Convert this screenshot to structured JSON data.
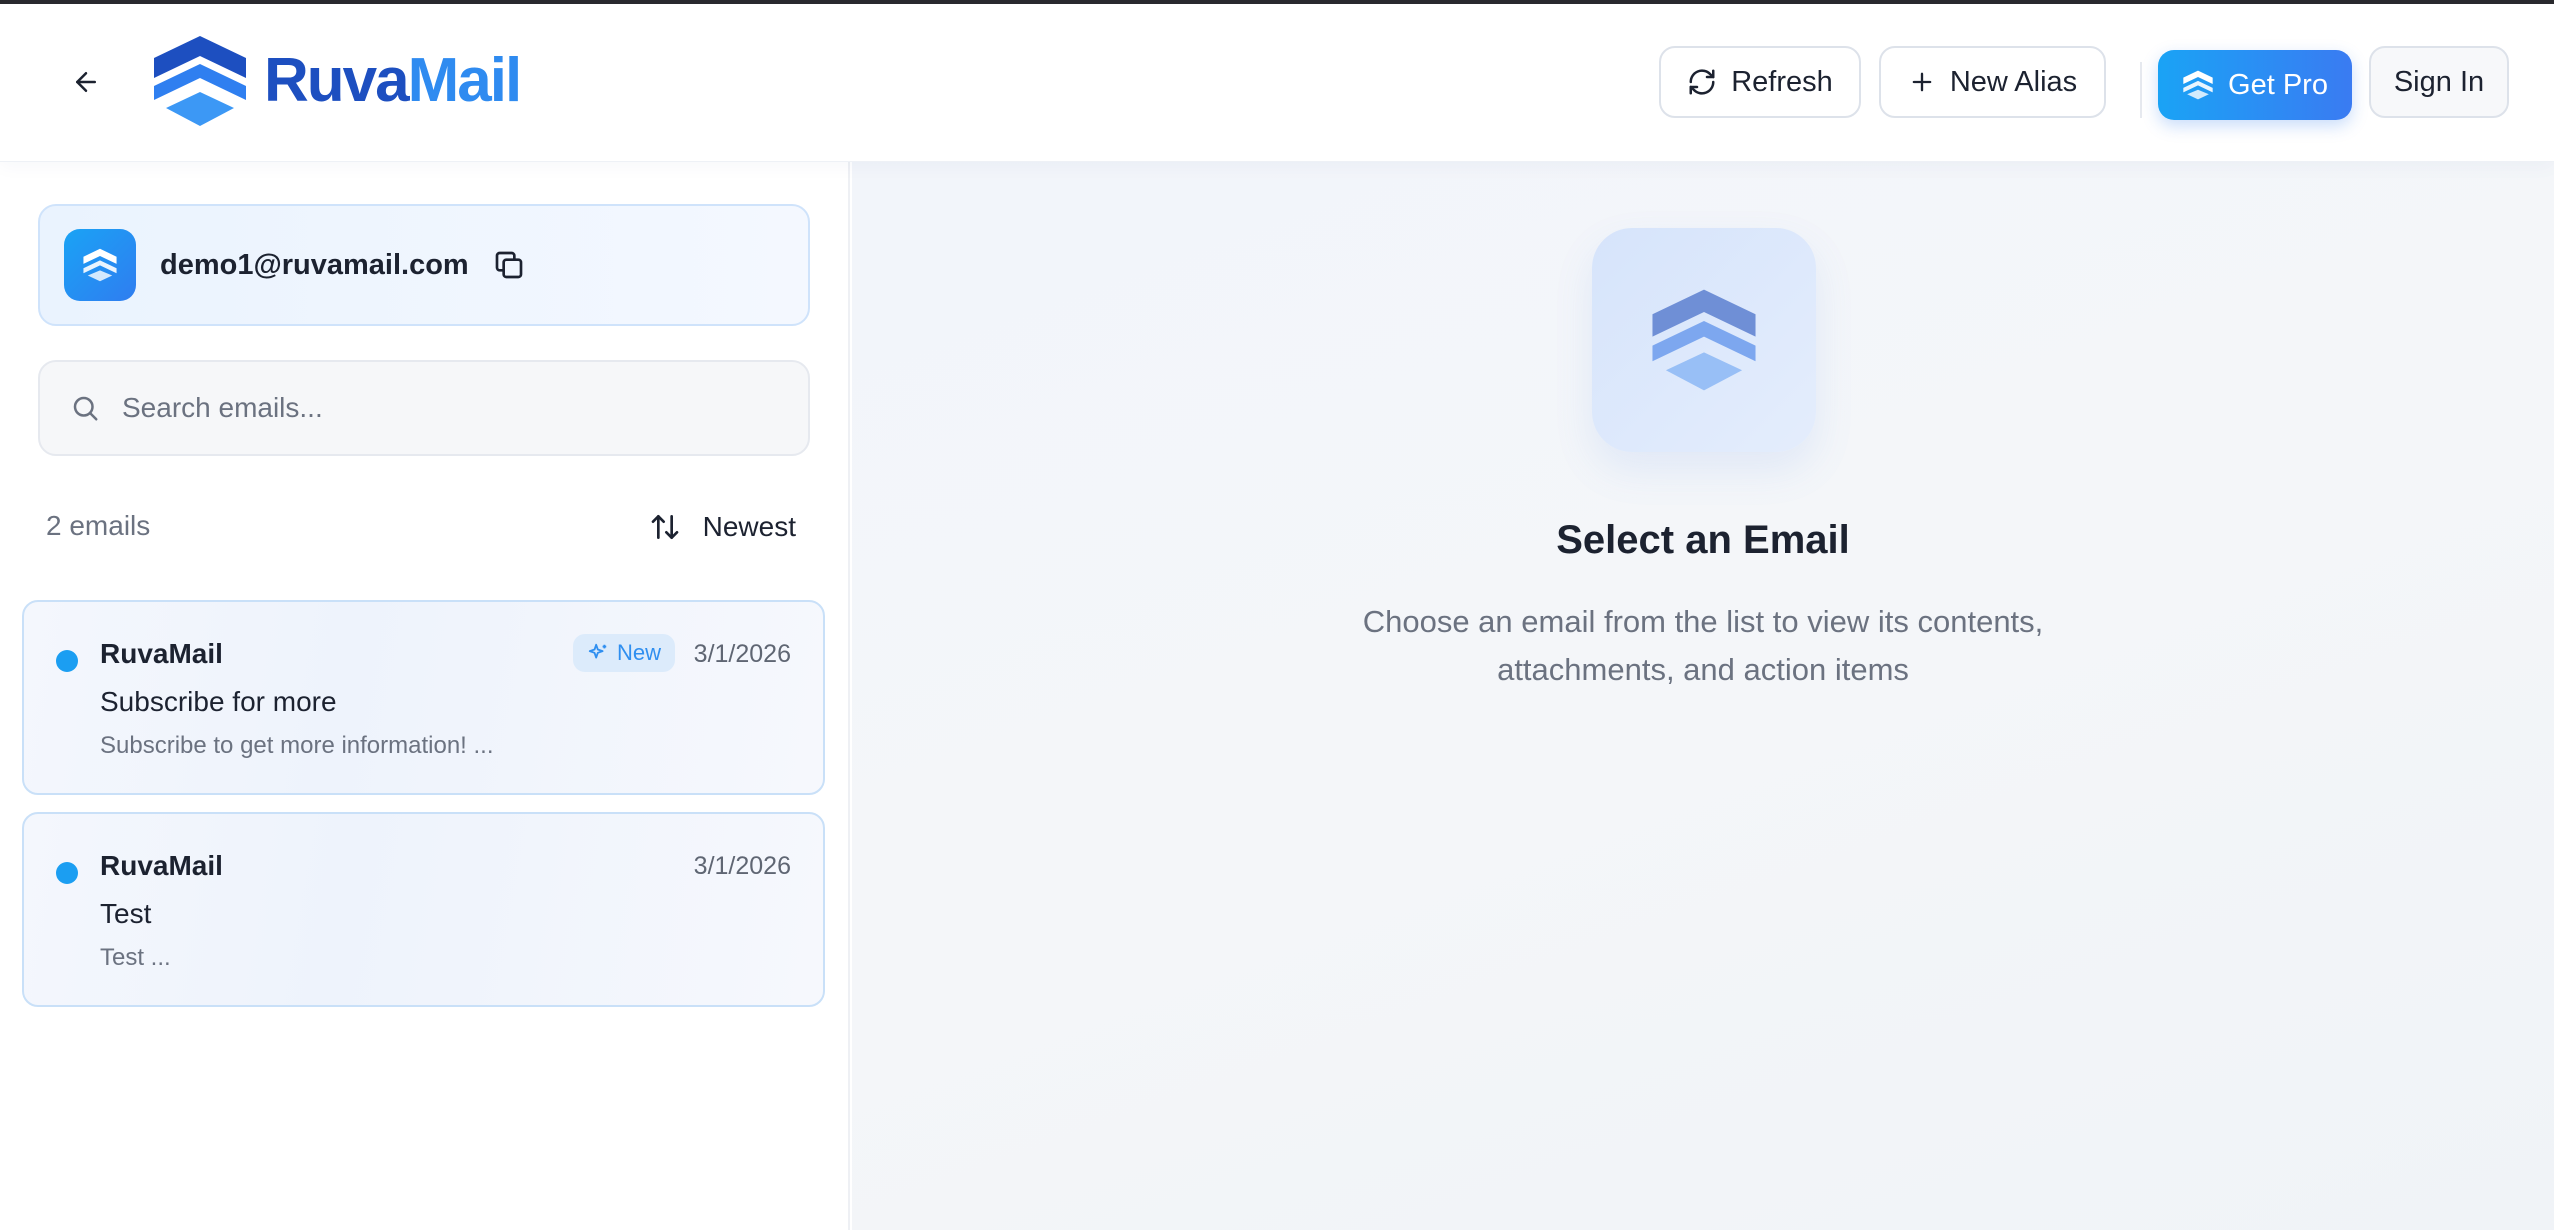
{
  "header": {
    "brand_part1": "Ruva",
    "brand_part2": "Mail",
    "refresh_label": "Refresh",
    "new_alias_label": "New Alias",
    "get_pro_label": "Get Pro",
    "sign_in_label": "Sign In"
  },
  "account": {
    "email": "demo1@ruvamail.com"
  },
  "search": {
    "placeholder": "Search emails...",
    "value": ""
  },
  "list": {
    "count_label": "2 emails",
    "sort_label": "Newest",
    "items": [
      {
        "sender": "RuvaMail",
        "badge": "New",
        "date": "3/1/2026",
        "subject": "Subscribe for more",
        "preview": "Subscribe to get more information! ..."
      },
      {
        "sender": "RuvaMail",
        "date": "3/1/2026",
        "subject": "Test",
        "preview": "Test ..."
      }
    ]
  },
  "empty_state": {
    "title": "Select an Email",
    "subtitle": "Choose an email from the list to view its contents, attachments, and action items"
  },
  "colors": {
    "brand_dark": "#1d4fc0",
    "brand_light": "#2f8bf0",
    "accent": "#1b9ef2",
    "pro_gradient_start": "#1aa3f5",
    "pro_gradient_end": "#3a7bf2"
  }
}
